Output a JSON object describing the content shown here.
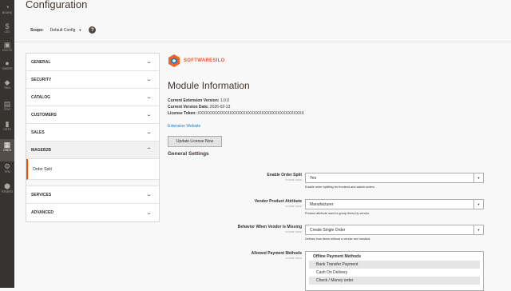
{
  "nav": [
    {
      "label": "BOARD",
      "glyph": "◔",
      "active": false
    },
    {
      "label": "LES",
      "glyph": "$",
      "active": false
    },
    {
      "label": "DUCTS",
      "glyph": "▣",
      "active": false
    },
    {
      "label": "OMERS",
      "glyph": "●",
      "active": false
    },
    {
      "label": "TING",
      "glyph": "◆",
      "active": false
    },
    {
      "label": "TENT",
      "glyph": "▤",
      "active": false
    },
    {
      "label": "ORTS",
      "glyph": "▮",
      "active": false
    },
    {
      "label": "ORES",
      "glyph": "▦",
      "active": true
    },
    {
      "label": "TEM",
      "glyph": "⚙",
      "active": false
    },
    {
      "label": "RTNERS",
      "glyph": "⬢",
      "active": false
    }
  ],
  "page": {
    "title": "Configuration"
  },
  "scope": {
    "label": "Scope:",
    "value": "Default Config",
    "caret": "▼",
    "help": "?"
  },
  "tabs": {
    "general": "GENERAL",
    "security": "SECURITY",
    "catalog": "CATALOG",
    "customers": "CUSTOMERS",
    "sales": "SALES",
    "mageb2b": "MAGEB2B",
    "order_split": "Order Split",
    "services": "SERVICES",
    "advanced": "ADVANCED",
    "chevron_down": "⌄",
    "chevron_up": "⌃"
  },
  "logo": {
    "text": "SOFTWARESILO",
    "colors": {
      "orange": "#f26322",
      "blue": "#1f7fc4"
    }
  },
  "module": {
    "title": "Module Information",
    "version_label": "Current Extension Version:",
    "version_value": "1.0.0",
    "date_label": "Current Version Date:",
    "date_value": "2026-02-13",
    "token_label": "License Token:",
    "token_value": "XXXXXXXXXXXXXXXXXXXXXXXXXXXXXXXXXXXXXXXX",
    "link": "Extension Website",
    "update_button": "Update License Now"
  },
  "settings": {
    "title": "General Settings",
    "scope_note": "[STORE VIEW]",
    "enable": {
      "label": "Enable Order Split",
      "value": "Yes",
      "note": "Enable order splitting for frontend and admin orders."
    },
    "vendor_attr": {
      "label": "Vendor Product Attribute",
      "value": "Manufacturer",
      "note": "Product attribute used to group items by vendor."
    },
    "missing": {
      "label": "Behavior When Vendor Is Missing",
      "value": "Create Single Order",
      "note": "Defines how items without a vendor are handled."
    },
    "payments": {
      "label": "Allowed Payment Methods",
      "group": "Offline Payment Methods",
      "options": [
        {
          "label": "Bank Transfer Payment",
          "selected": true
        },
        {
          "label": "Cash On Delivery",
          "selected": false
        },
        {
          "label": "Check / Money order",
          "selected": true
        }
      ]
    }
  },
  "colors": {
    "accent": "#eb5202",
    "nav_bg": "#373330",
    "link": "#1979c3"
  }
}
